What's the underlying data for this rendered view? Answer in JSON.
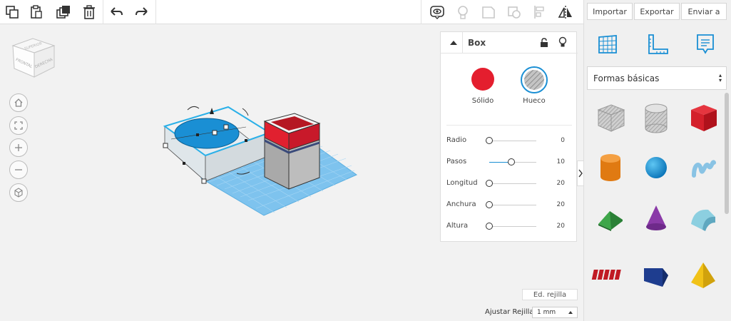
{
  "toolbar": {
    "icons": [
      "copy-icon",
      "paste-icon",
      "duplicate-icon",
      "trash-icon",
      "undo-icon",
      "redo-icon",
      "eye-icon",
      "lightbulb-icon",
      "group-icon",
      "ungroup-icon",
      "align-icon",
      "mirror-icon"
    ]
  },
  "top_menu": {
    "import_label": "Importar",
    "export_label": "Exportar",
    "send_label": "Enviar a"
  },
  "view_cube": {
    "front_label": "FRONTAL",
    "right_label": "DERECHA",
    "top_label": "SUPERIOR"
  },
  "inspector": {
    "title": "Box",
    "solid_label": "Sólido",
    "hole_label": "Hueco",
    "solid_color": "#e41e2e",
    "properties": [
      {
        "label": "Radio",
        "value": "0",
        "fraction": 0.0
      },
      {
        "label": "Pasos",
        "value": "10",
        "fraction": 0.47
      },
      {
        "label": "Longitud",
        "value": "20",
        "fraction": 0.0
      },
      {
        "label": "Anchura",
        "value": "20",
        "fraction": 0.0
      },
      {
        "label": "Altura",
        "value": "20",
        "fraction": 0.0
      }
    ]
  },
  "shapes_panel": {
    "category": "Formas básicas",
    "shapes": [
      "box-hole",
      "cylinder-hole",
      "box",
      "cylinder",
      "sphere",
      "scribble",
      "roof",
      "cone",
      "round-roof",
      "text",
      "wedge",
      "pyramid"
    ]
  },
  "grid": {
    "edit_label": "Ed. rejilla",
    "snap_label": "Ajustar Rejilla",
    "snap_value": "1 mm"
  },
  "colors": {
    "accent_blue": "#1a8fd4",
    "workplane_blue": "#7ec3ee"
  }
}
